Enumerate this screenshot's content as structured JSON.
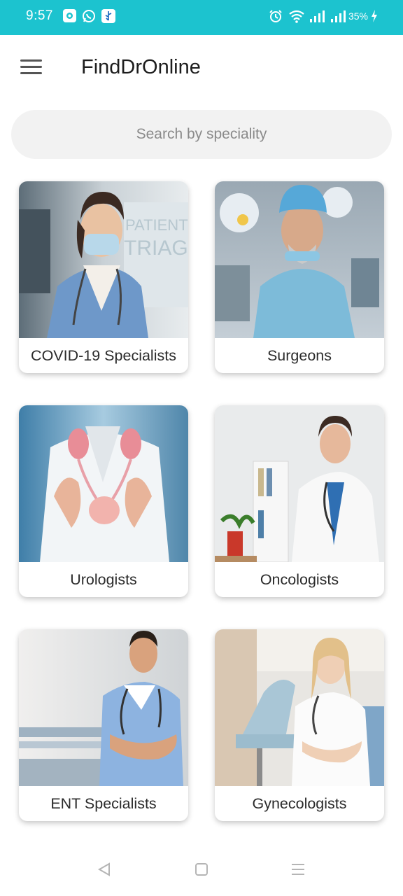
{
  "status_bar": {
    "time": "9:57",
    "battery": "35%",
    "icons": [
      "app-notification-icon",
      "whatsapp-icon",
      "usb-icon",
      "alarm-icon",
      "wifi-icon",
      "signal-icon",
      "signal-icon-2",
      "charging-icon"
    ]
  },
  "app_bar": {
    "title": "FindDrOnline",
    "menu_icon": "hamburger-menu-icon"
  },
  "search": {
    "placeholder": "Search by speciality",
    "value": ""
  },
  "specialities": [
    {
      "label": "COVID-19 Specialists"
    },
    {
      "label": "Surgeons"
    },
    {
      "label": "Urologists"
    },
    {
      "label": "Oncologists"
    },
    {
      "label": "ENT Specialists"
    },
    {
      "label": "Gynecologists"
    }
  ],
  "nav_bar": {
    "icons": [
      "back-icon",
      "home-icon",
      "recents-icon"
    ]
  },
  "colors": {
    "status_bar": "#1cc3cf",
    "search_bg": "#f2f2f2",
    "title": "#1d1d1d"
  }
}
